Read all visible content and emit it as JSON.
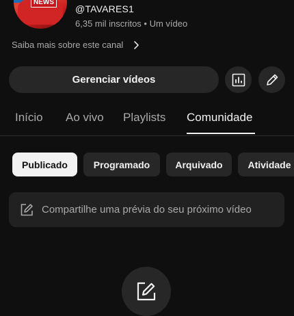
{
  "channel": {
    "avatar_badge": "NEWS",
    "handle": "@TAVARES1",
    "stats": "6,35 mil inscritos • Um vídeo",
    "about_link": "Saiba mais sobre este canal"
  },
  "actions": {
    "manage_label": "Gerenciar vídeos",
    "analytics_icon": "analytics-icon",
    "edit_icon": "pencil-icon"
  },
  "tabs": [
    {
      "label": "Início",
      "active": false
    },
    {
      "label": "Ao vivo",
      "active": false
    },
    {
      "label": "Playlists",
      "active": false
    },
    {
      "label": "Comunidade",
      "active": true
    }
  ],
  "filters": [
    {
      "label": "Publicado",
      "selected": true
    },
    {
      "label": "Programado",
      "selected": false
    },
    {
      "label": "Arquivado",
      "selected": false
    },
    {
      "label": "Atividade",
      "selected": false
    }
  ],
  "post": {
    "placeholder": "Compartilhe uma prévia do seu próximo vídeo"
  },
  "colors": {
    "background": "#0f0f0f",
    "surface": "#272727",
    "input_surface": "#212121",
    "text_primary": "#f1f1f1",
    "text_secondary": "#aaaaaa",
    "chip_selected": "#f1f1f1",
    "badge_red": "#c5161d"
  }
}
